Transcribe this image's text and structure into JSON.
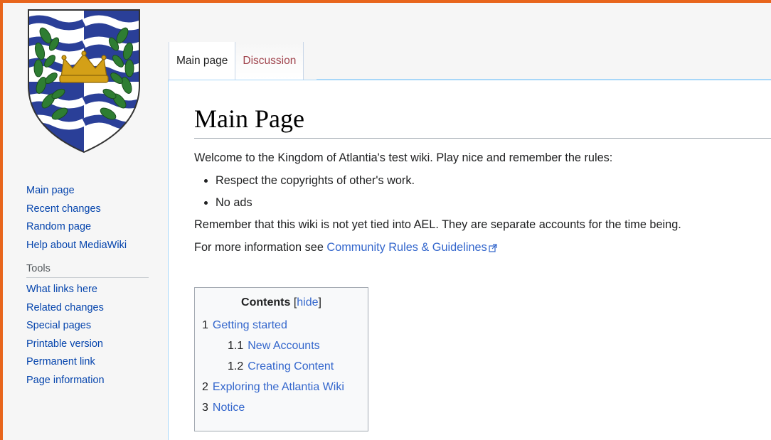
{
  "logo": {
    "icon": "atlantia-coat-of-arms-icon"
  },
  "navigation": {
    "items": [
      {
        "label": "Main page"
      },
      {
        "label": "Recent changes"
      },
      {
        "label": "Random page"
      },
      {
        "label": "Help about MediaWiki"
      }
    ]
  },
  "tools": {
    "heading": "Tools",
    "items": [
      {
        "label": "What links here"
      },
      {
        "label": "Related changes"
      },
      {
        "label": "Special pages"
      },
      {
        "label": "Printable version"
      },
      {
        "label": "Permanent link"
      },
      {
        "label": "Page information"
      }
    ]
  },
  "tabs": [
    {
      "label": "Main page",
      "selected": true
    },
    {
      "label": "Discussion",
      "selected": false
    }
  ],
  "page": {
    "title": "Main Page",
    "intro": "Welcome to the Kingdom of Atlantia's test wiki. Play nice and remember the rules:",
    "rules": [
      "Respect the copyrights of other's work.",
      "No ads"
    ],
    "notice": "Remember that this wiki is not yet tied into AEL. They are separate accounts for the time being.",
    "more_info_prefix": "For more information see ",
    "more_info_link": "Community Rules & Guidelines"
  },
  "toc": {
    "title": "Contents",
    "hide_open": "[",
    "hide_label": "hide",
    "hide_close": "]",
    "items": [
      {
        "num": "1",
        "label": "Getting started",
        "level": 1
      },
      {
        "num": "1.1",
        "label": "New Accounts",
        "level": 2
      },
      {
        "num": "1.2",
        "label": "Creating Content",
        "level": 2
      },
      {
        "num": "2",
        "label": "Exploring the Atlantia Wiki",
        "level": 1
      },
      {
        "num": "3",
        "label": "Notice",
        "level": 1
      }
    ]
  },
  "colors": {
    "frame": "#e8651c",
    "link": "#0645ad",
    "content_link": "#3366cc",
    "shield_blue": "#2a3f98",
    "laurel_green": "#2e7d32",
    "crown_gold": "#d4a017"
  }
}
